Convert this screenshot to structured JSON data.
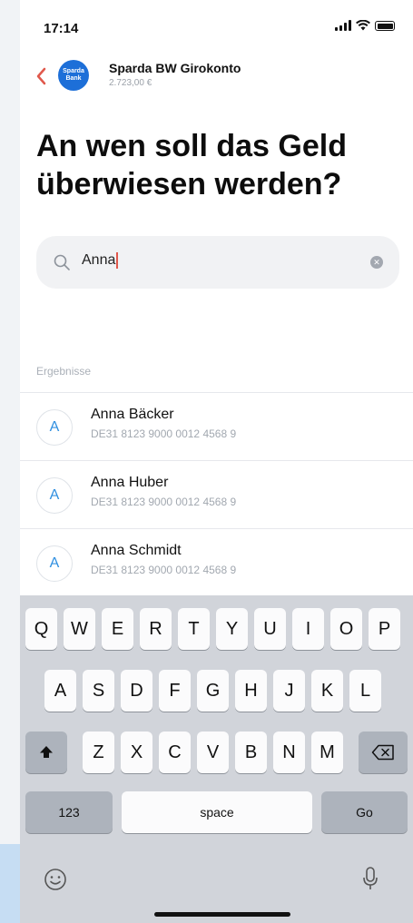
{
  "status": {
    "time": "17:14"
  },
  "header": {
    "back_icon": "chevron-left-icon",
    "bank_logo_text": "Sparda Bank",
    "account_name": "Sparda BW Girokonto",
    "balance": "2.723,00 €"
  },
  "title": "An wen soll das Geld überwiesen werden?",
  "search": {
    "value": "Anna",
    "icon": "search-icon",
    "clear_icon": "clear-icon"
  },
  "results_label": "Ergebnisse",
  "results": [
    {
      "initial": "A",
      "name": "Anna Bäcker",
      "iban": "DE31 8123 9000 0012 4568 9"
    },
    {
      "initial": "A",
      "name": "Anna Huber",
      "iban": "DE31 8123 9000 0012 4568 9"
    },
    {
      "initial": "A",
      "name": "Anna Schmidt",
      "iban": "DE31 8123 9000 0012 4568 9"
    }
  ],
  "keyboard": {
    "row1": [
      "Q",
      "W",
      "E",
      "R",
      "T",
      "Y",
      "U",
      "I",
      "O",
      "P"
    ],
    "row2": [
      "A",
      "S",
      "D",
      "F",
      "G",
      "H",
      "J",
      "K",
      "L"
    ],
    "row3": [
      "Z",
      "X",
      "C",
      "V",
      "B",
      "N",
      "M"
    ],
    "numbers_label": "123",
    "space_label": "space",
    "go_label": "Go",
    "shift_icon": "shift-icon",
    "backspace_icon": "backspace-icon",
    "emoji_icon": "emoji-icon",
    "mic_icon": "microphone-icon"
  },
  "colors": {
    "accent": "#e0584c",
    "brand": "#1d6fd8",
    "avatar_text": "#2f8fe0"
  }
}
